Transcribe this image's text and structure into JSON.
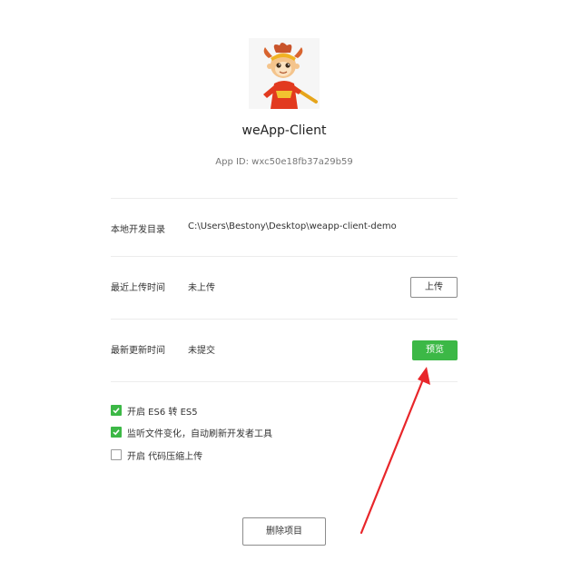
{
  "app": {
    "name": "weApp-Client",
    "app_id": "App ID: wxc50e18fb37a29b59",
    "avatar_icon": "monkey-king-avatar-icon"
  },
  "rows": [
    {
      "label": "本地开发目录",
      "value": "C:\\Users\\Bestony\\Desktop\\weapp-client-demo"
    },
    {
      "label": "最近上传时间",
      "value": "未上传",
      "button": "上传"
    },
    {
      "label": "最新更新时间",
      "value": "未提交",
      "button": "预览"
    }
  ],
  "options": [
    {
      "label": "开启 ES6 转 ES5",
      "checked": true
    },
    {
      "label": "监听文件变化，自动刷新开发者工具",
      "checked": true
    },
    {
      "label": "开启 代码压缩上传",
      "checked": false
    }
  ],
  "delete_button": "删除项目",
  "colors": {
    "accent_green": "#3cb846",
    "annotation_arrow": "#e8262a"
  }
}
